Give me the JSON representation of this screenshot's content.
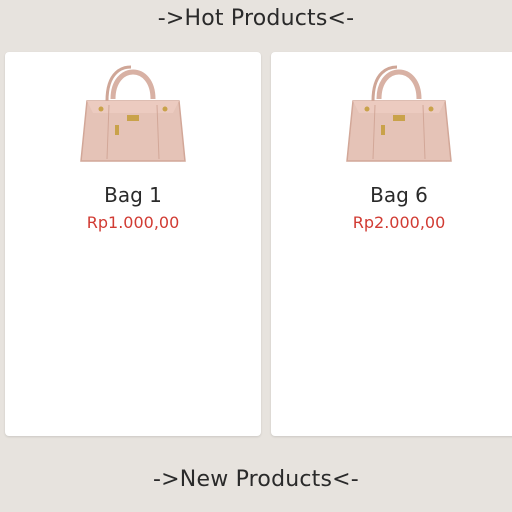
{
  "sections": {
    "hot_title": "->Hot Products<-",
    "new_title": "->New Products<-"
  },
  "products": [
    {
      "name": "Bag 1",
      "price": "Rp1.000,00",
      "image_icon": "handbag-image"
    },
    {
      "name": "Bag 6",
      "price": "Rp2.000,00",
      "image_icon": "handbag-image"
    }
  ],
  "colors": {
    "background": "#e7e3de",
    "card": "#ffffff",
    "price": "#d13b33",
    "bag": "#e2bfb3"
  }
}
